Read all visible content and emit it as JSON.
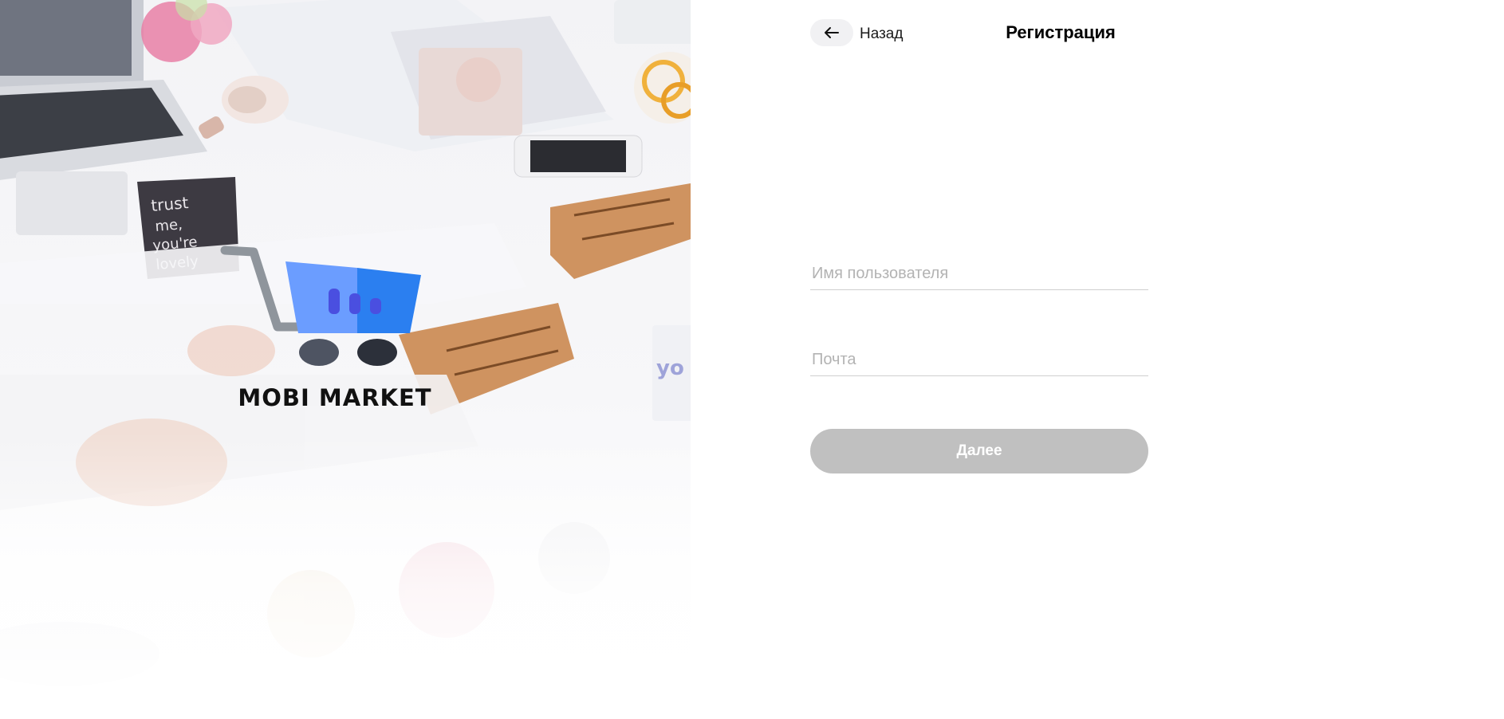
{
  "hero": {
    "brand": "MOBI MARKET",
    "logo_icon": "shopping-cart-icon",
    "colors": {
      "cart_light": "#6b9dff",
      "cart_dark": "#2b7ff0",
      "cart_bars": "#4a4fe0",
      "wheel_left": "#4e5462",
      "wheel_right": "#2c303a",
      "handle": "#8f959c"
    }
  },
  "header": {
    "back_icon": "arrow-left-icon",
    "back_label": "Назад",
    "title": "Регистрация"
  },
  "form": {
    "username_placeholder": "Имя пользователя",
    "username_value": "",
    "email_placeholder": "Почта",
    "email_value": "",
    "next_label": "Далее",
    "next_button_color": "#c0c0c0"
  }
}
